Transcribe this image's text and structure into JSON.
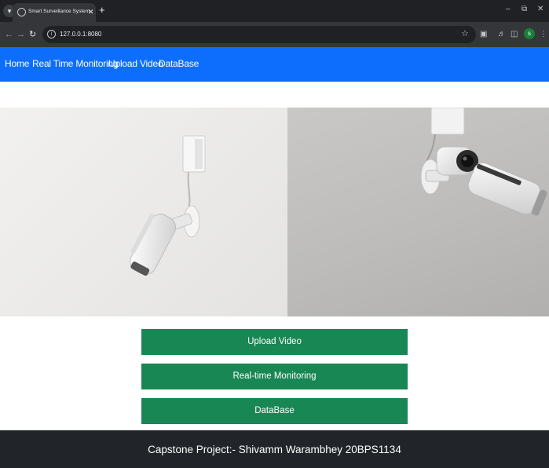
{
  "browser": {
    "tab_title": "Smart Surveillance System",
    "url": "127.0.0.1:8080",
    "profile_initial": "s",
    "icons": [
      "tab-search-icon",
      "globe-icon",
      "close-icon",
      "plus-icon",
      "back-icon",
      "forward-icon",
      "reload-icon",
      "site-info-icon",
      "star-icon",
      "extensions-icon",
      "media-icon",
      "sidepanel-icon",
      "kebab-menu-icon",
      "minimize-icon",
      "restore-icon",
      "window-close-icon"
    ]
  },
  "navbar": {
    "links": [
      "Home",
      "Real Time Monitoring",
      "Upload Video",
      "DataBase"
    ],
    "color": "#0d6efd"
  },
  "hero": {
    "left_image": "white security camera on light wall",
    "right_image": "security camera on grey wall"
  },
  "actions": {
    "buttons": [
      "Upload Video",
      "Real-time Monitoring",
      "DataBase"
    ],
    "color": "#198754"
  },
  "footer": {
    "text": "Capstone Project:- Shivamm Warambhey 20BPS1134",
    "color": "#212529"
  }
}
